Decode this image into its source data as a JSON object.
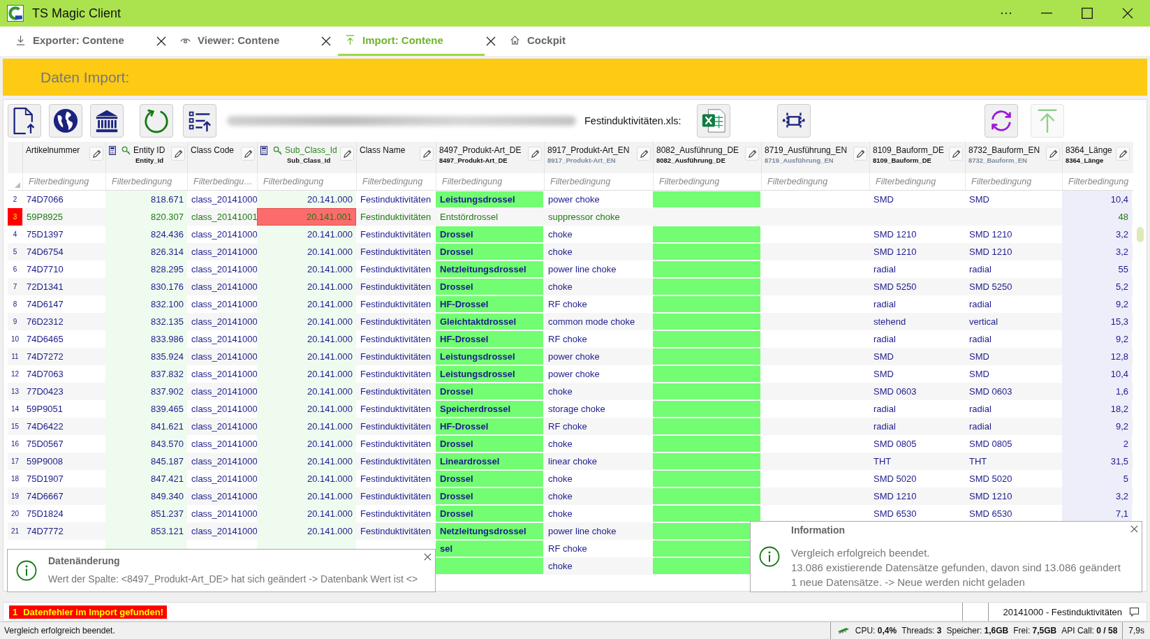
{
  "window": {
    "title": "TS Magic Client"
  },
  "tabs": [
    {
      "kind": "export",
      "label": "Exporter: Contene",
      "closable": true,
      "selected": false
    },
    {
      "kind": "view",
      "label": "Viewer: Contene",
      "closable": true,
      "selected": false
    },
    {
      "kind": "import",
      "label": "Import: Contene",
      "closable": true,
      "selected": true
    },
    {
      "kind": "home",
      "label": "Cockpit",
      "closable": false,
      "selected": false
    }
  ],
  "header": {
    "title": "Daten Import:"
  },
  "toolbar": {
    "file_label": "Festinduktivitäten.xls:",
    "buttons": [
      {
        "kind": "new-file",
        "disabled": false
      },
      {
        "kind": "globe",
        "disabled": false
      },
      {
        "kind": "bank",
        "disabled": false
      },
      {
        "kind": "refresh",
        "disabled": false
      },
      {
        "kind": "list-upload",
        "disabled": false
      },
      {
        "kind": "excel",
        "disabled": false
      },
      {
        "kind": "columns",
        "disabled": false
      },
      {
        "kind": "sync",
        "disabled": false
      },
      {
        "kind": "upload",
        "disabled": true
      }
    ]
  },
  "table": {
    "columns": [
      {
        "title": "Artikelnummer",
        "kind": "text",
        "highlighted": false,
        "filter_placeholder": "Filterbedingung"
      },
      {
        "title": "Entity ID",
        "subtitle": "Entity_Id",
        "secondary": false,
        "kind": "key",
        "highlighted": false,
        "filter_placeholder": "Filterbedingung"
      },
      {
        "title": "Class Code",
        "kind": "text",
        "highlighted": false,
        "filter_placeholder": "Filterbedingu…"
      },
      {
        "title": "Sub_Class_Id",
        "subtitle": "Sub_Class_Id",
        "secondary": false,
        "kind": "key",
        "highlighted": true,
        "filter_placeholder": "Filterbedingung"
      },
      {
        "title": "Class Name",
        "kind": "text",
        "highlighted": false,
        "filter_placeholder": "Filterbedingung"
      },
      {
        "title": "8497_Produkt-Art_DE",
        "subtitle": "8497_Produkt-Art_DE",
        "secondary": false,
        "kind": "compared",
        "highlighted": false,
        "filter_placeholder": "Filterbedingung"
      },
      {
        "title": "8917_Produkt-Art_EN",
        "subtitle": "8917_Produkt-Art_EN",
        "secondary": true,
        "kind": "text",
        "highlighted": false,
        "filter_placeholder": "Filterbedingung"
      },
      {
        "title": "8082_Ausführung_DE",
        "subtitle": "8082_Ausführung_DE",
        "secondary": false,
        "kind": "compared",
        "highlighted": false,
        "filter_placeholder": "Filterbedingung"
      },
      {
        "title": "8719_Ausführung_EN",
        "subtitle": "8719_Ausführung_EN",
        "secondary": true,
        "kind": "text",
        "highlighted": false,
        "filter_placeholder": "Filterbedingung"
      },
      {
        "title": "8109_Bauform_DE",
        "subtitle": "8109_Bauform_DE",
        "secondary": false,
        "kind": "text",
        "highlighted": false,
        "filter_placeholder": "Filterbedingung"
      },
      {
        "title": "8732_Bauform_EN",
        "subtitle": "8732_Bauform_EN",
        "secondary": true,
        "kind": "text",
        "highlighted": false,
        "filter_placeholder": "Filterbedingung"
      },
      {
        "title": "8364_Länge",
        "subtitle": "8364_Länge",
        "secondary": false,
        "kind": "measure",
        "highlighted": false,
        "filter_placeholder": "Filterbedingung"
      }
    ],
    "rows": [
      {
        "n": "2",
        "new": false,
        "error": false,
        "cells": [
          "74D7066",
          "818.671",
          "class_20141000",
          "20.141.000",
          "Festinduktivitäten",
          "Leistungsdrossel",
          "power choke",
          null,
          null,
          "SMD",
          "SMD",
          "10,4"
        ]
      },
      {
        "n": "3",
        "new": true,
        "error": true,
        "cells": [
          "59P8925",
          "820.307",
          "class_20141001",
          "20.141.001",
          "Festinduktivitäten",
          "Entstördrossel",
          "suppressor choke",
          null,
          null,
          null,
          null,
          "48"
        ]
      },
      {
        "n": "4",
        "new": false,
        "error": false,
        "cells": [
          "75D1397",
          "824.436",
          "class_20141000",
          "20.141.000",
          "Festinduktivitäten",
          "Drossel",
          "choke",
          null,
          null,
          "SMD 1210",
          "SMD 1210",
          "3,2"
        ]
      },
      {
        "n": "5",
        "new": false,
        "error": false,
        "cells": [
          "74D6754",
          "826.314",
          "class_20141000",
          "20.141.000",
          "Festinduktivitäten",
          "Drossel",
          "choke",
          null,
          null,
          "SMD 1210",
          "SMD 1210",
          "3,2"
        ]
      },
      {
        "n": "6",
        "new": false,
        "error": false,
        "cells": [
          "74D7710",
          "828.295",
          "class_20141000",
          "20.141.000",
          "Festinduktivitäten",
          "Netzleitungsdrossel",
          "power line choke",
          null,
          null,
          "radial",
          "radial",
          "55"
        ]
      },
      {
        "n": "7",
        "new": false,
        "error": false,
        "cells": [
          "72D1341",
          "830.176",
          "class_20141000",
          "20.141.000",
          "Festinduktivitäten",
          "Drossel",
          "choke",
          null,
          null,
          "SMD 5250",
          "SMD 5250",
          "5,2"
        ]
      },
      {
        "n": "8",
        "new": false,
        "error": false,
        "cells": [
          "74D6147",
          "832.100",
          "class_20141000",
          "20.141.000",
          "Festinduktivitäten",
          "HF-Drossel",
          "RF choke",
          null,
          null,
          "radial",
          "radial",
          "9,2"
        ]
      },
      {
        "n": "9",
        "new": false,
        "error": false,
        "cells": [
          "76D2312",
          "832.135",
          "class_20141000",
          "20.141.000",
          "Festinduktivitäten",
          "Gleichtaktdrossel",
          "common mode choke",
          null,
          null,
          "stehend",
          "vertical",
          "15,3"
        ]
      },
      {
        "n": "10",
        "new": false,
        "error": false,
        "cells": [
          "74D6465",
          "833.986",
          "class_20141000",
          "20.141.000",
          "Festinduktivitäten",
          "HF-Drossel",
          "RF choke",
          null,
          null,
          "radial",
          "radial",
          "9,2"
        ]
      },
      {
        "n": "11",
        "new": false,
        "error": false,
        "cells": [
          "74D7272",
          "835.924",
          "class_20141000",
          "20.141.000",
          "Festinduktivitäten",
          "Leistungsdrossel",
          "power choke",
          null,
          null,
          "SMD",
          "SMD",
          "12,8"
        ]
      },
      {
        "n": "12",
        "new": false,
        "error": false,
        "cells": [
          "74D7063",
          "837.832",
          "class_20141000",
          "20.141.000",
          "Festinduktivitäten",
          "Leistungsdrossel",
          "power choke",
          null,
          null,
          "SMD",
          "SMD",
          "10,4"
        ]
      },
      {
        "n": "13",
        "new": false,
        "error": false,
        "cells": [
          "77D0423",
          "837.902",
          "class_20141000",
          "20.141.000",
          "Festinduktivitäten",
          "Drossel",
          "choke",
          null,
          null,
          "SMD 0603",
          "SMD 0603",
          "1,6"
        ]
      },
      {
        "n": "14",
        "new": false,
        "error": false,
        "cells": [
          "59P9051",
          "839.465",
          "class_20141000",
          "20.141.000",
          "Festinduktivitäten",
          "Speicherdrossel",
          "storage choke",
          null,
          null,
          "radial",
          "radial",
          "18,2"
        ]
      },
      {
        "n": "15",
        "new": false,
        "error": false,
        "cells": [
          "74D6422",
          "841.621",
          "class_20141000",
          "20.141.000",
          "Festinduktivitäten",
          "HF-Drossel",
          "RF choke",
          null,
          null,
          "radial",
          "radial",
          "9,2"
        ]
      },
      {
        "n": "16",
        "new": false,
        "error": false,
        "cells": [
          "75D0567",
          "843.570",
          "class_20141000",
          "20.141.000",
          "Festinduktivitäten",
          "Drossel",
          "choke",
          null,
          null,
          "SMD 0805",
          "SMD 0805",
          "2"
        ]
      },
      {
        "n": "17",
        "new": false,
        "error": false,
        "cells": [
          "59P9008",
          "845.187",
          "class_20141000",
          "20.141.000",
          "Festinduktivitäten",
          "Lineardrossel",
          "linear choke",
          null,
          null,
          "THT",
          "THT",
          "31,5"
        ]
      },
      {
        "n": "18",
        "new": false,
        "error": false,
        "cells": [
          "75D1907",
          "847.421",
          "class_20141000",
          "20.141.000",
          "Festinduktivitäten",
          "Drossel",
          "choke",
          null,
          null,
          "SMD 5020",
          "SMD 5020",
          "5"
        ]
      },
      {
        "n": "19",
        "new": false,
        "error": false,
        "cells": [
          "74D6667",
          "849.340",
          "class_20141000",
          "20.141.000",
          "Festinduktivitäten",
          "Drossel",
          "choke",
          null,
          null,
          "SMD 1210",
          "SMD 1210",
          "3,2"
        ]
      },
      {
        "n": "20",
        "new": false,
        "error": false,
        "cells": [
          "75D1824",
          "851.237",
          "class_20141000",
          "20.141.000",
          "Festinduktivitäten",
          "Drossel",
          "choke",
          null,
          null,
          "SMD 6530",
          "SMD 6530",
          "7,1"
        ]
      },
      {
        "n": "21",
        "new": false,
        "error": false,
        "cells": [
          "74D7772",
          "853.121",
          "class_20141000",
          "20.141.000",
          "Festinduktivitäten",
          "Netzleitungsdrossel",
          "power line choke",
          null,
          null,
          null,
          null,
          null
        ]
      },
      {
        "new": false,
        "cells": [
          null,
          null,
          null,
          null,
          null,
          "sel",
          "RF choke",
          null,
          null,
          null,
          null,
          null
        ]
      },
      {
        "new": false,
        "cells": [
          null,
          null,
          null,
          null,
          null,
          null,
          "choke",
          null,
          null,
          null,
          null,
          null
        ]
      }
    ]
  },
  "error_bar": {
    "count": "1",
    "message": "Datenfehler im Import gefunden!",
    "context": "20141000 - Festinduktivitäten"
  },
  "toasts": [
    {
      "kind": "change",
      "title": "Datenänderung",
      "lines": [
        "Wert der Spalte: <8497_Produkt-Art_DE> hat sich geändert -> Datenbank Wert ist <>"
      ]
    },
    {
      "kind": "info",
      "title": "Information",
      "lines": [
        "Vergleich erfolgreich beendet.",
        "13.086 existierende Datensätze gefunden, davon sind 13.086 geändert",
        "1 neue Datensätze. -> Neue werden nicht geladen"
      ]
    }
  ],
  "status_bar": {
    "message": "Vergleich erfolgreich beendet.",
    "metrics": [
      "CPU: **0,4%**",
      "Threads: **3**",
      "Speicher: **1,6GB**",
      "Frei: **7,5GB**",
      "API Call: **0 / 58**"
    ],
    "duration": "7,9s"
  }
}
